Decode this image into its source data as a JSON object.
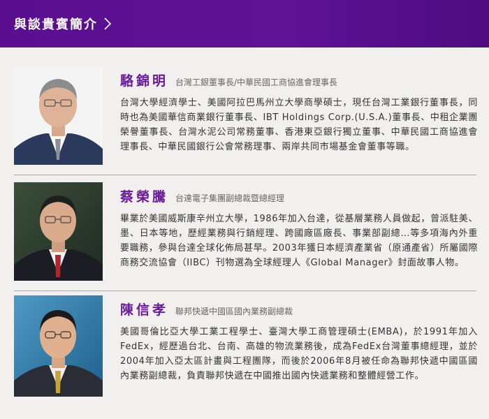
{
  "header": {
    "title": "與談貴賓簡介"
  },
  "guests": [
    {
      "name": "駱錦明",
      "title": "台灣工銀董事長/中華民國工商協進會理事長",
      "bio": "台灣大學經濟學士、美國阿拉巴馬州立大學商學碩士，現任台灣工業銀行董事長，同時也為美國華信商業銀行董事長、IBT Holdings Corp.(U.S.A.)董事長、中租企業團榮譽董事長、台灣水泥公司常務董事、香港東亞銀行獨立董事、中華民國工商協進會理事長、中華民國銀行公會常務理事、兩岸共同市場基金會董事等職。"
    },
    {
      "name": "蔡榮騰",
      "title": "台達電子集團副總裁暨總經理",
      "bio": "畢業於美國威斯康辛州立大學，1986年加入台達，從基層業務人員做起，曾派駐美、墨、日本等地，歷經業務與行銷經理、跨國廠區廠長、事業部副總…等多項海內外重要職務，參與台達全球化佈局甚早。2003年獲日本經濟產業省（原通產省）所屬國際商務交流協會（IIBC）刊物選為全球經理人《Global Manager》封面故事人物。"
    },
    {
      "name": "陳信孝",
      "title": "聯邦快遞中國區國內業務副總裁",
      "bio": "美國哥倫比亞大學工業工程學士、臺灣大學工商管理碩士(EMBA)，於1991年加入FedEx，經歷過台北、台南、高雄的物流業務後，成為FedEx台灣董事總經理，並於2004年加入亞太區計畫與工程團隊，而後於2006年8月被任命為聯邦快遞中國區國內業務副總裁，負責聯邦快遞在中國推出國內快遞業務和整體經營工作。"
    }
  ]
}
